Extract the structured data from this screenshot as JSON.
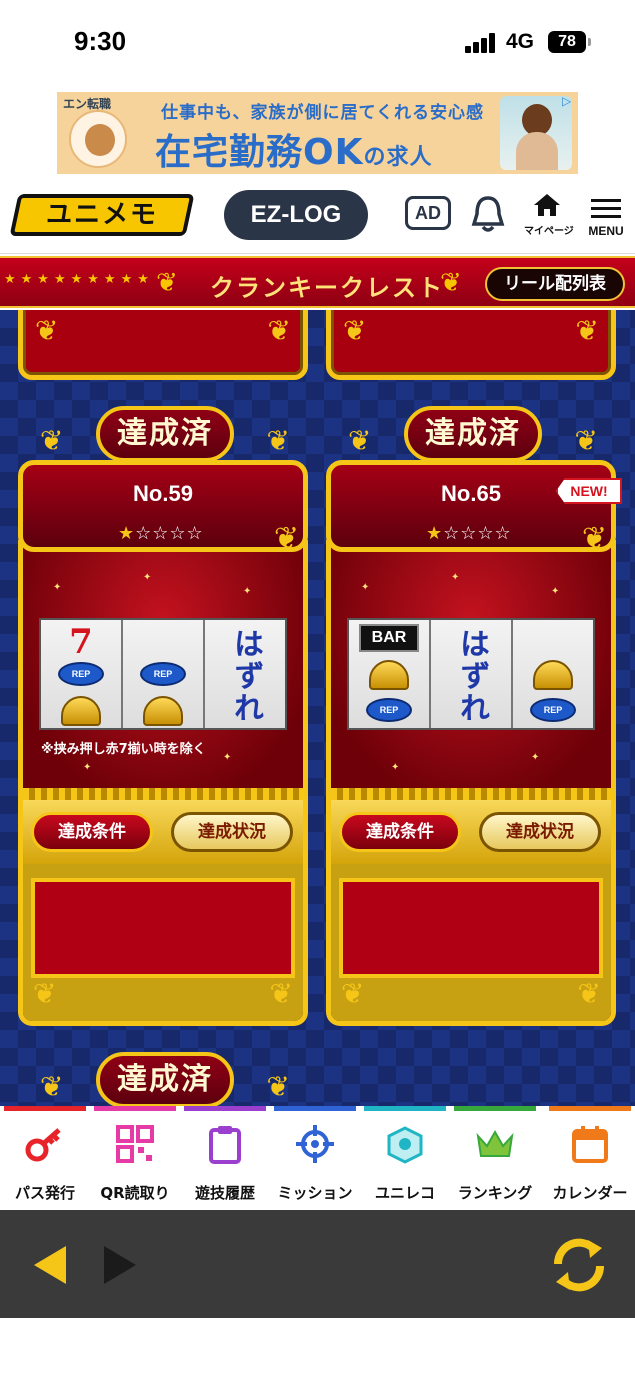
{
  "status": {
    "time": "9:30",
    "network": "4G",
    "battery": "78"
  },
  "ad": {
    "logo": "エン転職",
    "line1": "仕事中も、家族が側に居てくれる安心感",
    "line2_main": "在宅勤務OK",
    "line2_suffix": "の求人"
  },
  "header": {
    "brand": "ユニメモ",
    "ezlog": "EZ-LOG",
    "ad_label": "AD",
    "mypage_label": "マイページ",
    "menu_label": "MENU"
  },
  "title_band": {
    "title": "クランキークレスト",
    "reel_button": "リール配列表"
  },
  "achieved_label": "達成済",
  "cards": [
    {
      "number": "No.59",
      "stars": {
        "filled": "★",
        "empty": "☆☆☆☆"
      },
      "new_badge": "",
      "reels": [
        "7 / REP / bell",
        "REP / bell",
        "はずれ"
      ],
      "symbol_rep": "REP",
      "miss_text": "はずれ",
      "note": "※挟み押し赤7揃い時を除く",
      "condition_button": "達成条件",
      "status_button": "達成状況"
    },
    {
      "number": "No.65",
      "stars": {
        "filled": "★",
        "empty": "☆☆☆☆"
      },
      "new_badge": "NEW!",
      "symbol_bar": "BAR",
      "symbol_rep": "REP",
      "miss_text": "はずれ",
      "condition_button": "達成条件",
      "status_button": "達成状況"
    }
  ],
  "tabs": [
    {
      "label": "パス発行",
      "color": "#e8242b",
      "icon": "key-icon"
    },
    {
      "label": "QR読取り",
      "color": "#e63aa7",
      "icon": "qr-icon"
    },
    {
      "label": "遊技履歴",
      "color": "#9b3fcf",
      "icon": "clipboard-icon"
    },
    {
      "label": "ミッション",
      "color": "#2f63d6",
      "icon": "target-icon"
    },
    {
      "label": "ユニレコ",
      "color": "#1fb5c4",
      "icon": "unireco-icon"
    },
    {
      "label": "ランキング",
      "color": "#37a83b",
      "icon": "crown-icon"
    },
    {
      "label": "カレンダー",
      "color": "#f07a1a",
      "icon": "calendar-icon"
    }
  ]
}
